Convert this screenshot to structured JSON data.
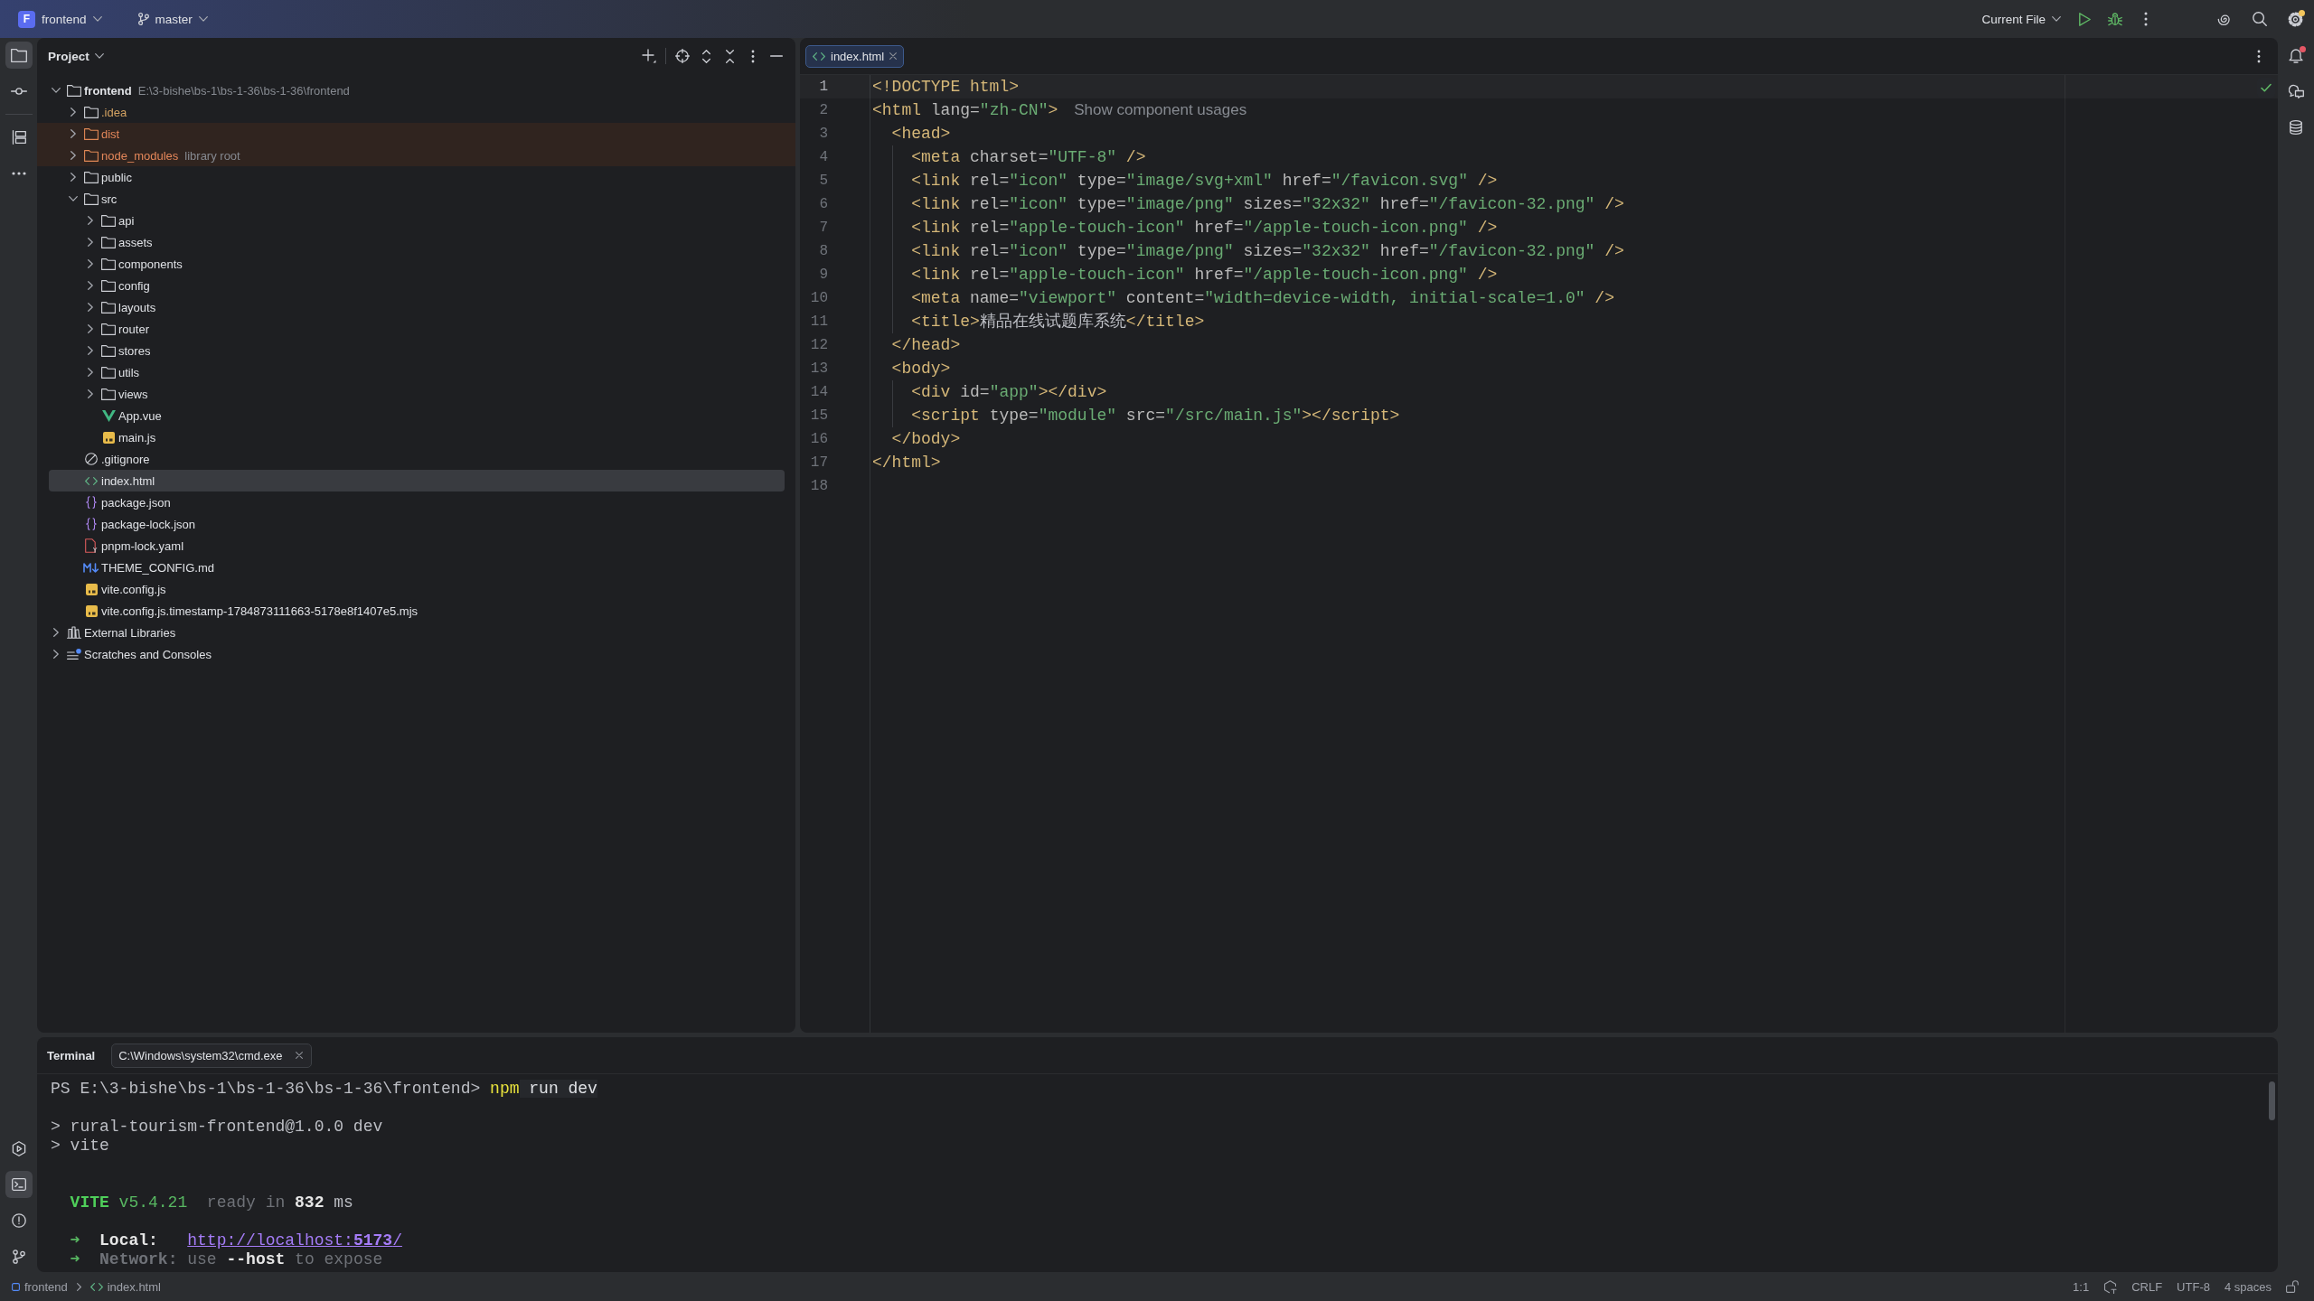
{
  "title_bar": {
    "project": {
      "initial": "F",
      "name": "frontend"
    },
    "branch": {
      "name": "master"
    },
    "run_configuration": {
      "name": "Current File"
    },
    "settings": {
      "update_available": true
    }
  },
  "left_toolbar": {
    "groups": [
      [
        {
          "kind": "project",
          "selected": true
        },
        {
          "kind": "commit",
          "selected": false
        }
      ],
      [
        {
          "kind": "structure",
          "selected": false
        },
        {
          "kind": "more",
          "selected": false
        }
      ]
    ],
    "bottom": [
      {
        "kind": "services",
        "selected": false
      },
      {
        "kind": "terminal",
        "selected": true
      },
      {
        "kind": "problems",
        "selected": false
      },
      {
        "kind": "git",
        "selected": false
      }
    ]
  },
  "project_panel": {
    "title": "Project",
    "tree": [
      {
        "name": "frontend",
        "kind": "module",
        "hint": "E:\\3-bishe\\bs-1\\bs-1-36\\bs-1-36\\frontend",
        "ignored": false,
        "excluded": false,
        "expanded": true,
        "selected": false,
        "children": [
          {
            "name": ".idea",
            "kind": "folder",
            "ignored": true,
            "excluded": false,
            "expanded": false,
            "selected": false
          },
          {
            "name": "dist",
            "kind": "folder",
            "ignored": false,
            "excluded": true,
            "expanded": false,
            "selected": false
          },
          {
            "name": "node_modules",
            "kind": "folder",
            "hint": "library root",
            "ignored": false,
            "excluded": true,
            "expanded": false,
            "selected": false
          },
          {
            "name": "public",
            "kind": "folder",
            "ignored": false,
            "excluded": false,
            "expanded": false,
            "selected": false
          },
          {
            "name": "src",
            "kind": "folder",
            "ignored": false,
            "excluded": false,
            "expanded": true,
            "selected": false,
            "children": [
              {
                "name": "api",
                "kind": "folder",
                "ignored": false,
                "excluded": false,
                "expanded": false,
                "selected": false
              },
              {
                "name": "assets",
                "kind": "folder",
                "ignored": false,
                "excluded": false,
                "expanded": false,
                "selected": false
              },
              {
                "name": "components",
                "kind": "folder",
                "ignored": false,
                "excluded": false,
                "expanded": false,
                "selected": false
              },
              {
                "name": "config",
                "kind": "folder",
                "ignored": false,
                "excluded": false,
                "expanded": false,
                "selected": false
              },
              {
                "name": "layouts",
                "kind": "folder",
                "ignored": false,
                "excluded": false,
                "expanded": false,
                "selected": false
              },
              {
                "name": "router",
                "kind": "folder",
                "ignored": false,
                "excluded": false,
                "expanded": false,
                "selected": false
              },
              {
                "name": "stores",
                "kind": "folder",
                "ignored": false,
                "excluded": false,
                "expanded": false,
                "selected": false
              },
              {
                "name": "utils",
                "kind": "folder",
                "ignored": false,
                "excluded": false,
                "expanded": false,
                "selected": false
              },
              {
                "name": "views",
                "kind": "folder",
                "ignored": false,
                "excluded": false,
                "expanded": false,
                "selected": false
              },
              {
                "name": "App.vue",
                "kind": "vue",
                "ignored": false,
                "excluded": false,
                "selected": false
              },
              {
                "name": "main.js",
                "kind": "js",
                "ignored": false,
                "excluded": false,
                "selected": false
              }
            ]
          },
          {
            "name": ".gitignore",
            "kind": "ignore",
            "ignored": false,
            "excluded": false,
            "selected": false
          },
          {
            "name": "index.html",
            "kind": "html",
            "ignored": false,
            "excluded": false,
            "selected": true
          },
          {
            "name": "package.json",
            "kind": "json",
            "ignored": false,
            "excluded": false,
            "selected": false
          },
          {
            "name": "package-lock.json",
            "kind": "json",
            "ignored": false,
            "excluded": false,
            "selected": false
          },
          {
            "name": "pnpm-lock.yaml",
            "kind": "yaml",
            "ignored": false,
            "excluded": false,
            "selected": false
          },
          {
            "name": "THEME_CONFIG.md",
            "kind": "markdown",
            "ignored": false,
            "excluded": false,
            "selected": false
          },
          {
            "name": "vite.config.js",
            "kind": "js",
            "ignored": false,
            "excluded": false,
            "selected": false
          },
          {
            "name": "vite.config.js.timestamp-1784873111663-5178e8f1407e5.mjs",
            "kind": "js",
            "ignored": false,
            "excluded": false,
            "selected": false
          }
        ]
      },
      {
        "name": "External Libraries",
        "kind": "libraries",
        "ignored": false,
        "excluded": false,
        "expanded": false,
        "selected": false
      },
      {
        "name": "Scratches and Consoles",
        "kind": "scratches",
        "ignored": false,
        "excluded": false,
        "expanded": false,
        "selected": false
      }
    ]
  },
  "editor": {
    "tabs": [
      {
        "label": "index.html",
        "kind": "html",
        "selected": true
      }
    ],
    "lines": [
      {
        "number": "1",
        "current": true,
        "tokens": [
          {
            "text": "<!DOCTYPE html>",
            "kind": "tag"
          }
        ]
      },
      {
        "number": "2",
        "current": false,
        "tokens": [
          {
            "text": "<html ",
            "kind": "tag"
          },
          {
            "text": "lang=",
            "kind": "attr"
          },
          {
            "text": "\"zh-CN\"",
            "kind": "value"
          },
          {
            "text": ">",
            "kind": "tag"
          }
        ],
        "hint": "Show component usages"
      },
      {
        "number": "3",
        "current": false,
        "tokens": [
          {
            "text": "  <head>",
            "kind": "tag"
          }
        ]
      },
      {
        "number": "4",
        "current": false,
        "tokens": [
          {
            "text": "    <meta ",
            "kind": "tag"
          },
          {
            "text": "charset=",
            "kind": "attr"
          },
          {
            "text": "\"UTF-8\"",
            "kind": "value"
          },
          {
            "text": " />",
            "kind": "tag"
          }
        ]
      },
      {
        "number": "5",
        "current": false,
        "tokens": [
          {
            "text": "    <link ",
            "kind": "tag"
          },
          {
            "text": "rel=",
            "kind": "attr"
          },
          {
            "text": "\"icon\"",
            "kind": "value"
          },
          {
            "text": " type=",
            "kind": "attr"
          },
          {
            "text": "\"image/svg+xml\"",
            "kind": "value"
          },
          {
            "text": " href=",
            "kind": "attr"
          },
          {
            "text": "\"/favicon.svg\"",
            "kind": "value"
          },
          {
            "text": " />",
            "kind": "tag"
          }
        ]
      },
      {
        "number": "6",
        "current": false,
        "tokens": [
          {
            "text": "    <link ",
            "kind": "tag"
          },
          {
            "text": "rel=",
            "kind": "attr"
          },
          {
            "text": "\"icon\"",
            "kind": "value"
          },
          {
            "text": " type=",
            "kind": "attr"
          },
          {
            "text": "\"image/png\"",
            "kind": "value"
          },
          {
            "text": " sizes=",
            "kind": "attr"
          },
          {
            "text": "\"32x32\"",
            "kind": "value"
          },
          {
            "text": " href=",
            "kind": "attr"
          },
          {
            "text": "\"/favicon-32.png\"",
            "kind": "value"
          },
          {
            "text": " />",
            "kind": "tag"
          }
        ]
      },
      {
        "number": "7",
        "current": false,
        "tokens": [
          {
            "text": "    <link ",
            "kind": "tag"
          },
          {
            "text": "rel=",
            "kind": "attr"
          },
          {
            "text": "\"apple-touch-icon\"",
            "kind": "value"
          },
          {
            "text": " href=",
            "kind": "attr"
          },
          {
            "text": "\"/apple-touch-icon.png\"",
            "kind": "value"
          },
          {
            "text": " />",
            "kind": "tag"
          }
        ]
      },
      {
        "number": "8",
        "current": false,
        "tokens": [
          {
            "text": "    <link ",
            "kind": "tag"
          },
          {
            "text": "rel=",
            "kind": "attr"
          },
          {
            "text": "\"icon\"",
            "kind": "value"
          },
          {
            "text": " type=",
            "kind": "attr"
          },
          {
            "text": "\"image/png\"",
            "kind": "value"
          },
          {
            "text": " sizes=",
            "kind": "attr"
          },
          {
            "text": "\"32x32\"",
            "kind": "value"
          },
          {
            "text": " href=",
            "kind": "attr"
          },
          {
            "text": "\"/favicon-32.png\"",
            "kind": "value"
          },
          {
            "text": " />",
            "kind": "tag"
          }
        ]
      },
      {
        "number": "9",
        "current": false,
        "tokens": [
          {
            "text": "    <link ",
            "kind": "tag"
          },
          {
            "text": "rel=",
            "kind": "attr"
          },
          {
            "text": "\"apple-touch-icon\"",
            "kind": "value"
          },
          {
            "text": " href=",
            "kind": "attr"
          },
          {
            "text": "\"/apple-touch-icon.png\"",
            "kind": "value"
          },
          {
            "text": " />",
            "kind": "tag"
          }
        ]
      },
      {
        "number": "10",
        "current": false,
        "tokens": [
          {
            "text": "    <meta ",
            "kind": "tag"
          },
          {
            "text": "name=",
            "kind": "attr"
          },
          {
            "text": "\"viewport\"",
            "kind": "value"
          },
          {
            "text": " content=",
            "kind": "attr"
          },
          {
            "text": "\"width=device-width, initial-scale=1.0\"",
            "kind": "value"
          },
          {
            "text": " />",
            "kind": "tag"
          }
        ]
      },
      {
        "number": "11",
        "current": false,
        "tokens": [
          {
            "text": "    <title>",
            "kind": "tag"
          },
          {
            "text": "精品在线试题库系统",
            "kind": "text"
          },
          {
            "text": "</title>",
            "kind": "tag"
          }
        ]
      },
      {
        "number": "12",
        "current": false,
        "tokens": [
          {
            "text": "  </head>",
            "kind": "tag"
          }
        ]
      },
      {
        "number": "13",
        "current": false,
        "tokens": [
          {
            "text": "  <body>",
            "kind": "tag"
          }
        ]
      },
      {
        "number": "14",
        "current": false,
        "tokens": [
          {
            "text": "    <div ",
            "kind": "tag"
          },
          {
            "text": "id=",
            "kind": "attr"
          },
          {
            "text": "\"app\"",
            "kind": "value"
          },
          {
            "text": "></div>",
            "kind": "tag"
          }
        ]
      },
      {
        "number": "15",
        "current": false,
        "tokens": [
          {
            "text": "    <script ",
            "kind": "tag"
          },
          {
            "text": "type=",
            "kind": "attr"
          },
          {
            "text": "\"module\"",
            "kind": "value"
          },
          {
            "text": " src=",
            "kind": "attr"
          },
          {
            "text": "\"/src/main.js\"",
            "kind": "value"
          },
          {
            "text": "></script>",
            "kind": "tag"
          }
        ]
      },
      {
        "number": "16",
        "current": false,
        "tokens": [
          {
            "text": "  </body>",
            "kind": "tag"
          }
        ]
      },
      {
        "number": "17",
        "current": false,
        "tokens": [
          {
            "text": "</html>",
            "kind": "tag"
          }
        ]
      },
      {
        "number": "18",
        "current": false
      }
    ]
  },
  "right_toolbar": [
    {
      "kind": "notifications",
      "selected": false,
      "unread": true
    },
    {
      "kind": "ai_chat",
      "selected": false,
      "unread": false
    },
    {
      "kind": "database",
      "selected": false,
      "unread": false
    }
  ],
  "terminal": {
    "title": "Terminal",
    "tabs": [
      {
        "label": "C:\\Windows\\system32\\cmd.exe",
        "selected": true
      }
    ],
    "lines": [
      {
        "kind": "text",
        "segments": [
          {
            "text": "PS E:\\3-bishe\\bs-1\\bs-1-36\\bs-1-36\\frontend> ",
            "kind": "plain"
          },
          {
            "text": "npm",
            "kind": "command"
          },
          {
            "text": " run dev",
            "kind": "argument"
          }
        ]
      },
      {
        "kind": "blank"
      },
      {
        "kind": "text",
        "segments": [
          {
            "text": "> rural-tourism-frontend@1.0.0 dev",
            "kind": "plain"
          }
        ]
      },
      {
        "kind": "text",
        "segments": [
          {
            "text": "> vite",
            "kind": "plain"
          }
        ]
      },
      {
        "kind": "blank"
      },
      {
        "kind": "blank"
      },
      {
        "kind": "text",
        "segments": [
          {
            "text": "  VITE",
            "kind": "brand"
          },
          {
            "text": " v5.4.21",
            "kind": "success"
          },
          {
            "text": "  ready in ",
            "kind": "muted"
          },
          {
            "text": "832",
            "kind": "strong"
          },
          {
            "text": " ms",
            "kind": "plain"
          }
        ]
      },
      {
        "kind": "blank"
      },
      {
        "kind": "text",
        "segments": [
          {
            "text": "  ➜",
            "kind": "success"
          },
          {
            "text": "  Local:   ",
            "kind": "strong"
          },
          {
            "text": "http://localhost:**5173**/",
            "kind": "link"
          }
        ]
      },
      {
        "kind": "text",
        "segments": [
          {
            "text": "  ➜",
            "kind": "success"
          },
          {
            "text": "  Network:",
            "kind": "label"
          },
          {
            "text": " use ",
            "kind": "muted"
          },
          {
            "text": "--host",
            "kind": "strong"
          },
          {
            "text": " to expose",
            "kind": "muted"
          }
        ]
      }
    ]
  },
  "status_bar": {
    "breadcrumbs": [
      {
        "label": "frontend",
        "kind": "module"
      },
      {
        "label": "index.html",
        "kind": "html"
      }
    ],
    "position": "1:1",
    "line_separator": "CRLF",
    "encoding": "UTF-8",
    "indent": "4 spaces"
  }
}
